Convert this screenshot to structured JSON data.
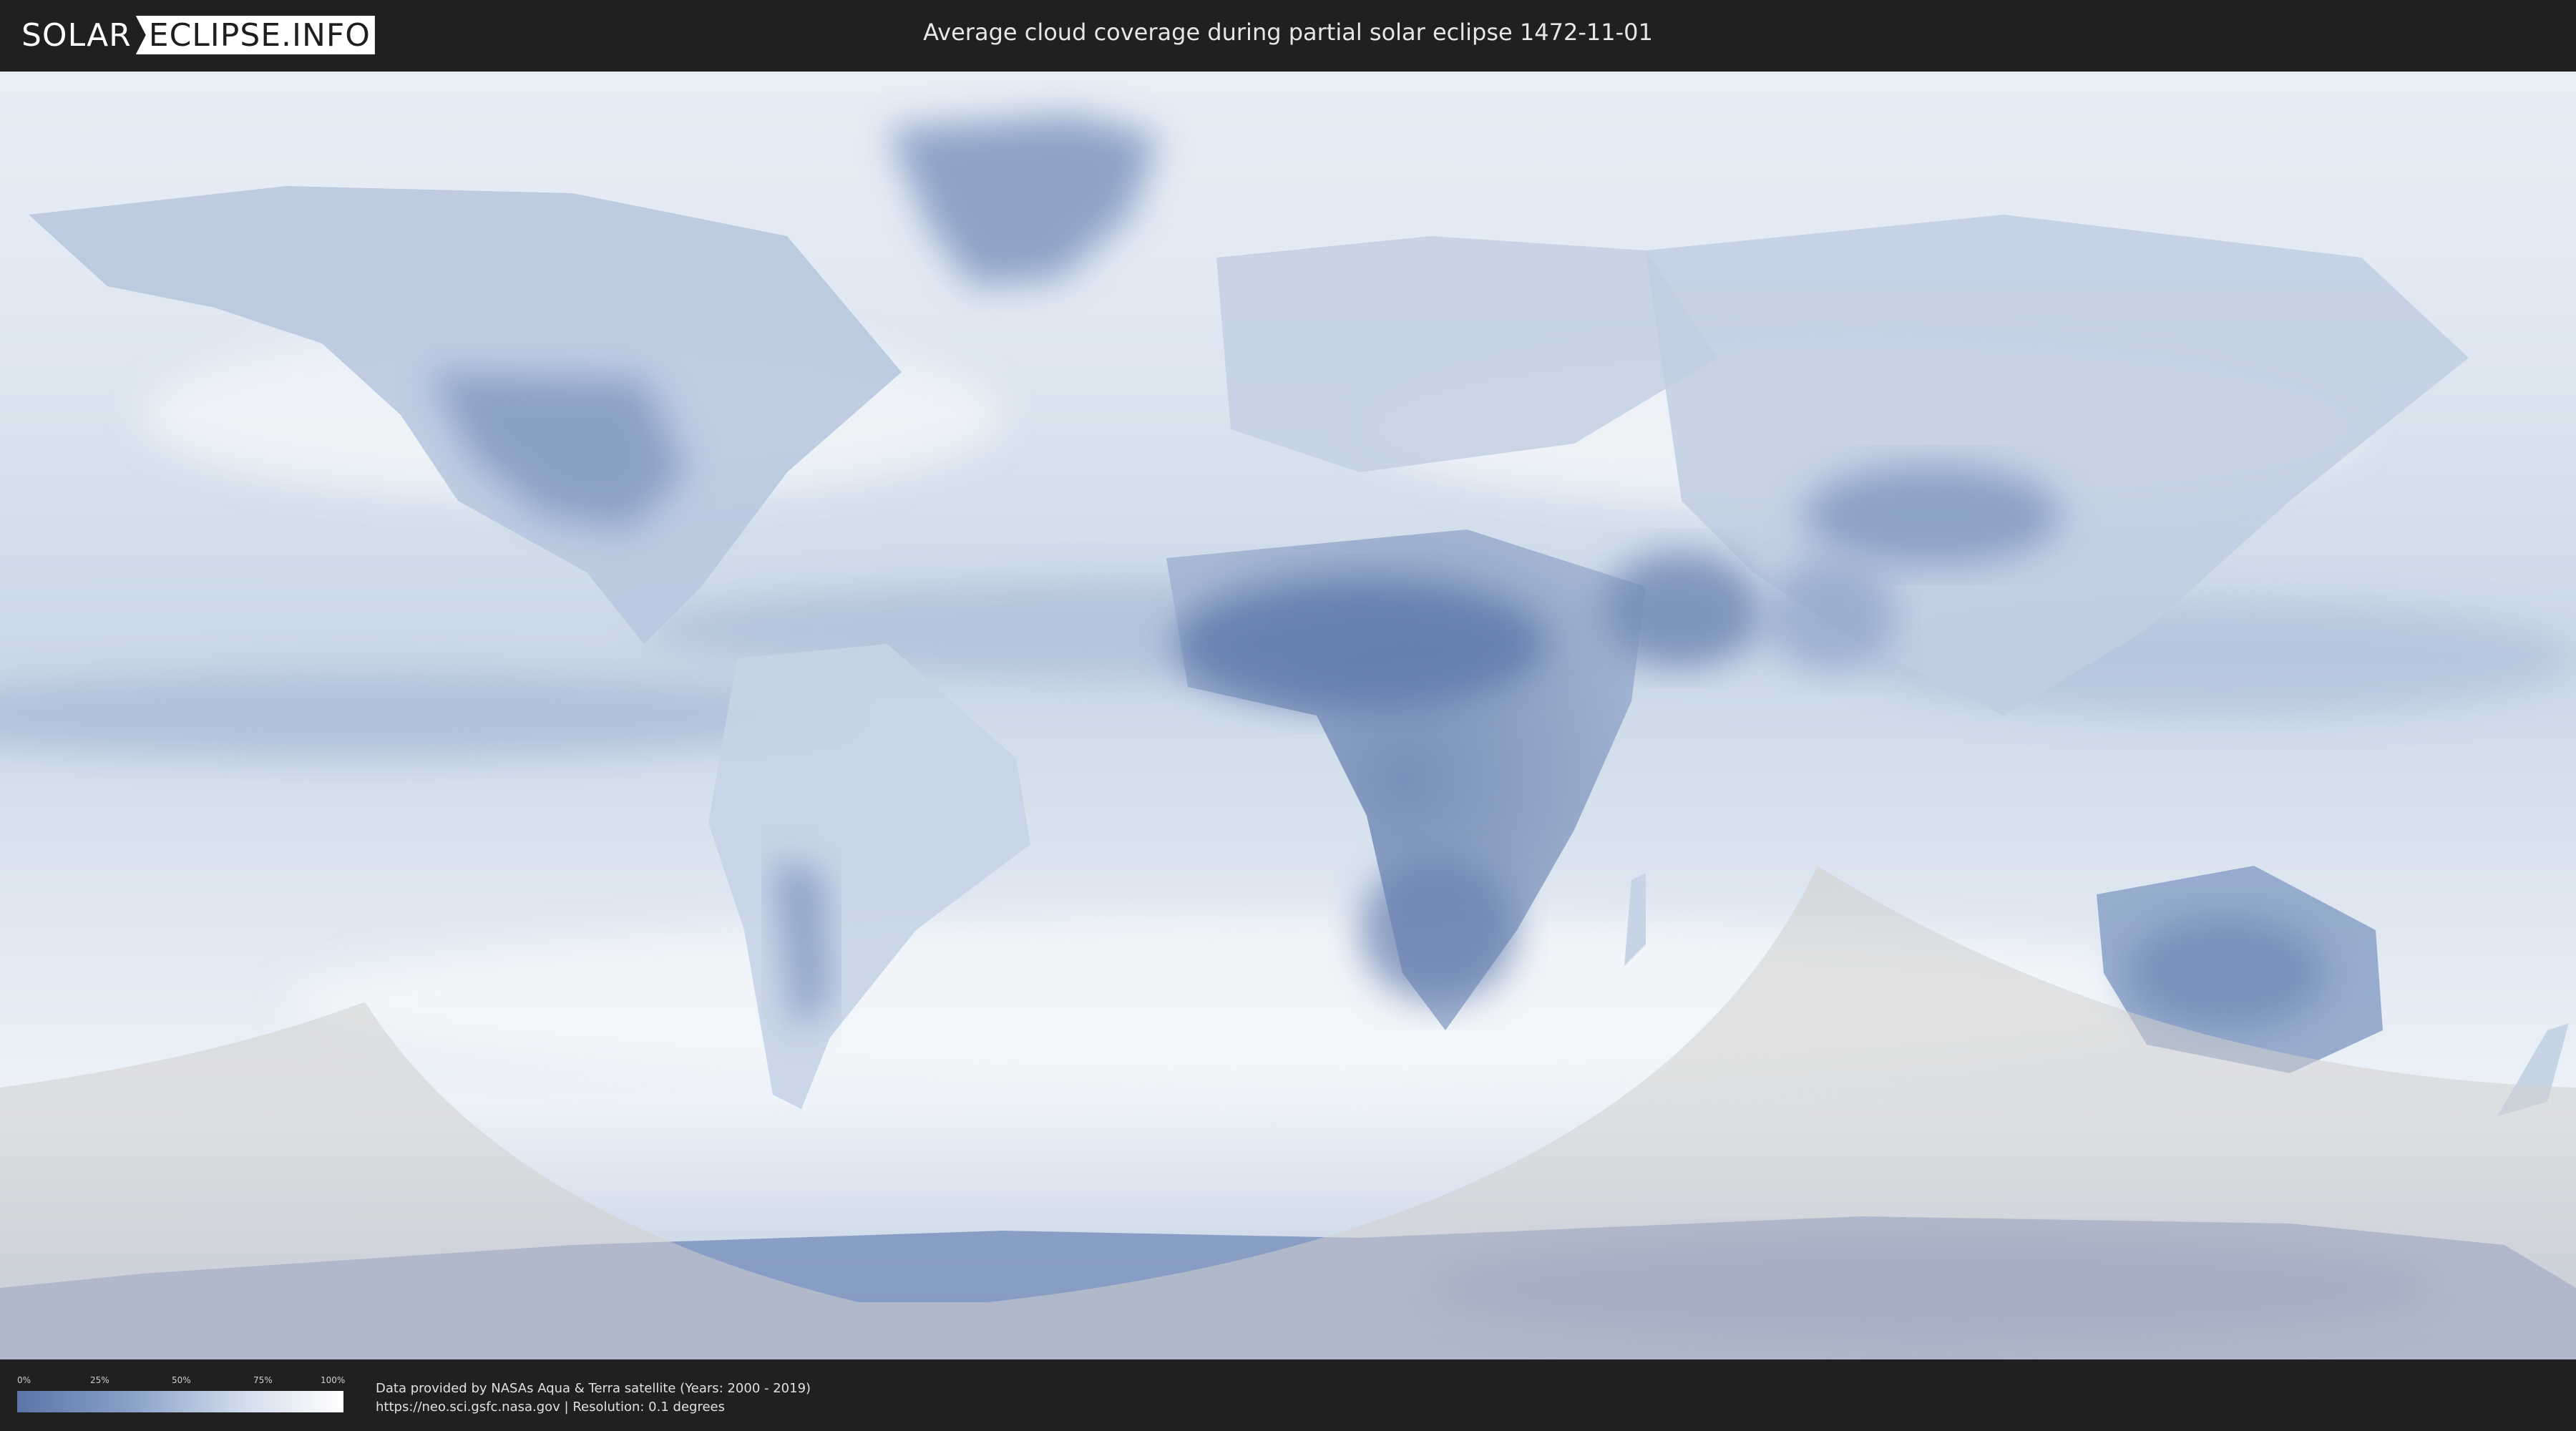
{
  "header": {
    "logo_part1": "SOLAR",
    "logo_part2": "ECLIPSE.INFO",
    "title": "Average cloud coverage during partial solar eclipse 1472-11-01"
  },
  "legend": {
    "ticks": [
      "0%",
      "25%",
      "50%",
      "75%",
      "100%"
    ],
    "gradient_colors": [
      "#5a74a8",
      "#8aa2c8",
      "#d3dded",
      "#ffffff"
    ]
  },
  "credits": {
    "line1": "Data provided by NASAs Aqua & Terra satellite (Years: 2000 - 2019)",
    "line2": "https://neo.sci.gsfc.nasa.gov | Resolution: 0.1 degrees"
  },
  "colors": {
    "background": "#202020",
    "clear_sky": "#5a74a8",
    "cloudy": "#ffffff",
    "no_eclipse_overlay": "#d0d0d0"
  }
}
